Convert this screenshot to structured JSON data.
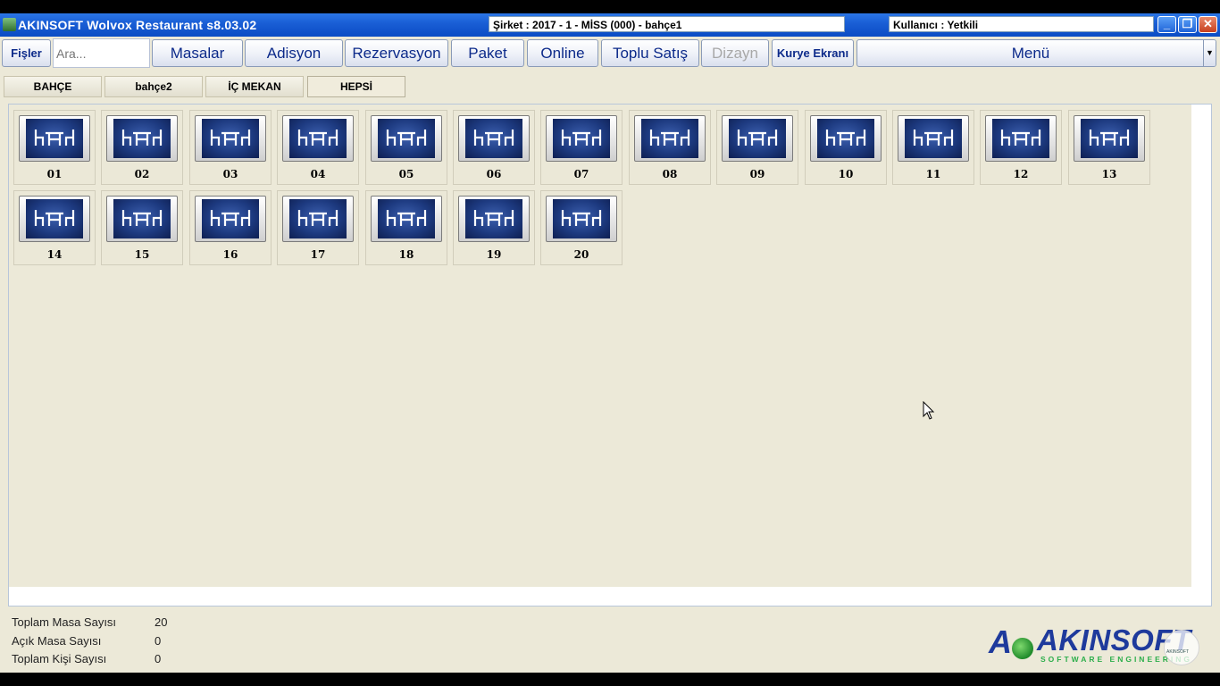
{
  "window": {
    "title": "AKINSOFT Wolvox Restaurant s8.03.02",
    "company_info": "Şirket : 2017 - 1 - MİSS (000) - bahçe1",
    "user_info": "Kullanıcı : Yetkili",
    "controls": {
      "minimize": "_",
      "restore": "❐",
      "close": "✕"
    }
  },
  "toolbar": {
    "fisler": "Fişler",
    "search_placeholder": "Ara...",
    "masalar": "Masalar",
    "adisyon": "Adisyon",
    "rezervasyon": "Rezervasyon",
    "paket": "Paket",
    "online": "Online",
    "toplu_satis": "Toplu Satış",
    "dizayn": "Dizayn",
    "kurye_ekrani": "Kurye Ekranı",
    "menu": "Menü",
    "menu_arrow": "▼"
  },
  "areas": [
    "BAHÇE",
    "bahçe2",
    "İÇ MEKAN",
    "HEPSİ"
  ],
  "active_area": "HEPSİ",
  "tables": [
    "01",
    "02",
    "03",
    "04",
    "05",
    "06",
    "07",
    "08",
    "09",
    "10",
    "11",
    "12",
    "13",
    "14",
    "15",
    "16",
    "17",
    "18",
    "19",
    "20"
  ],
  "stats": {
    "total_tables_label": "Toplam Masa Sayısı",
    "total_tables": "20",
    "open_tables_label": "Açık Masa Sayısı",
    "open_tables": "0",
    "total_people_label": "Toplam Kişi Sayısı",
    "total_people": "0"
  },
  "logo": {
    "mark": "A",
    "name": "AKINSOFT",
    "tagline": "SOFTWARE ENGINEERING",
    "watermark": "AKINSOFT"
  },
  "colors": {
    "titlebar": "#0a4cc4",
    "button_text": "#0c2a8a",
    "disabled_text": "#a8a8a8",
    "table_icon": "#1d3a80",
    "logo_blue": "#1e3a9c",
    "logo_green": "#2cae4b"
  }
}
